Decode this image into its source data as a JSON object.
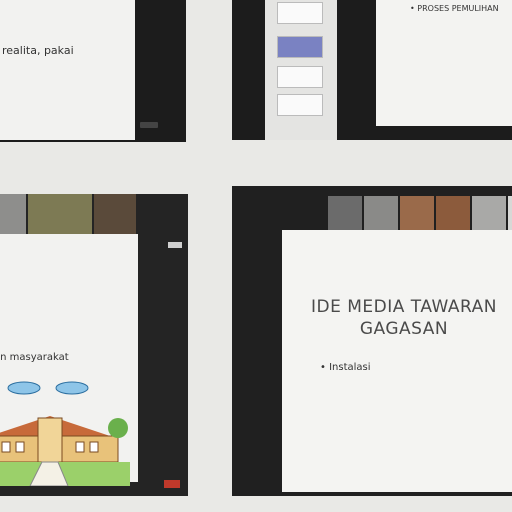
{
  "tiles": {
    "one": {
      "slide_text": "realita, pakai"
    },
    "two": {
      "slide_bullet": "• PROSES PEMULIHAN"
    },
    "three": {
      "slide_text": "an masyarakat"
    },
    "four": {
      "title_line1": "IDE MEDIA TAWARAN",
      "title_line2": "GAGASAN",
      "bullet": "• Instalasi"
    }
  },
  "colors": {
    "background": "#e9e9e6",
    "frame": "#1c1c1c",
    "slide": "#f2f2f0",
    "record": "#c0392b"
  },
  "icons": [
    "video-thumbnail",
    "drawing-illustration",
    "stop-button"
  ]
}
